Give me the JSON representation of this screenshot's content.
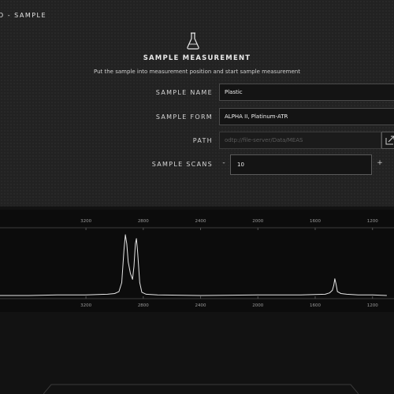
{
  "header": {
    "breadcrumb": "D - SAMPLE"
  },
  "section": {
    "icon": "flask-icon",
    "title": "SAMPLE MEASUREMENT",
    "instruction": "Put the sample into measurement position and start sample measurement"
  },
  "form": {
    "sample_name": {
      "label": "SAMPLE NAME",
      "value": "Plastic"
    },
    "sample_form": {
      "label": "SAMPLE FORM",
      "value": "ALPHA II, Platinum-ATR"
    },
    "path": {
      "label": "PATH",
      "value": "odtp://file-server/Data/MEAS"
    },
    "sample_scans": {
      "label": "SAMPLE SCANS",
      "value": "10",
      "decrement": "-",
      "increment": "+"
    }
  },
  "colors": {
    "panel": "#222222",
    "background": "#121212",
    "trace": "#e6e6e6"
  },
  "chart_data": {
    "type": "line",
    "x_ticks_top": [
      "3200",
      "2800",
      "2400",
      "2000",
      "1600",
      "1200"
    ],
    "x_ticks_bottom": [
      "3200",
      "2800",
      "2400",
      "2000",
      "1600",
      "1200"
    ],
    "x_reversed": true,
    "xlim": [
      3800,
      1050
    ],
    "ylim": [
      0,
      1
    ],
    "grid": false,
    "series": [
      {
        "x": [
          3800,
          3600,
          3400,
          3200,
          3050,
          3000,
          2970,
          2950,
          2935,
          2925,
          2915,
          2905,
          2890,
          2875,
          2865,
          2855,
          2848,
          2840,
          2825,
          2810,
          2780,
          2700,
          2400,
          2000,
          1700,
          1530,
          1500,
          1480,
          1470,
          1463,
          1455,
          1445,
          1420,
          1380,
          1300,
          1200,
          1100
        ],
        "y": [
          0.0,
          0.0,
          0.01,
          0.01,
          0.02,
          0.03,
          0.06,
          0.2,
          0.7,
          0.94,
          0.8,
          0.52,
          0.34,
          0.25,
          0.45,
          0.8,
          0.88,
          0.7,
          0.2,
          0.05,
          0.02,
          0.01,
          0.0,
          0.01,
          0.01,
          0.02,
          0.04,
          0.08,
          0.16,
          0.26,
          0.18,
          0.06,
          0.03,
          0.02,
          0.01,
          0.01,
          0.0
        ]
      }
    ]
  }
}
